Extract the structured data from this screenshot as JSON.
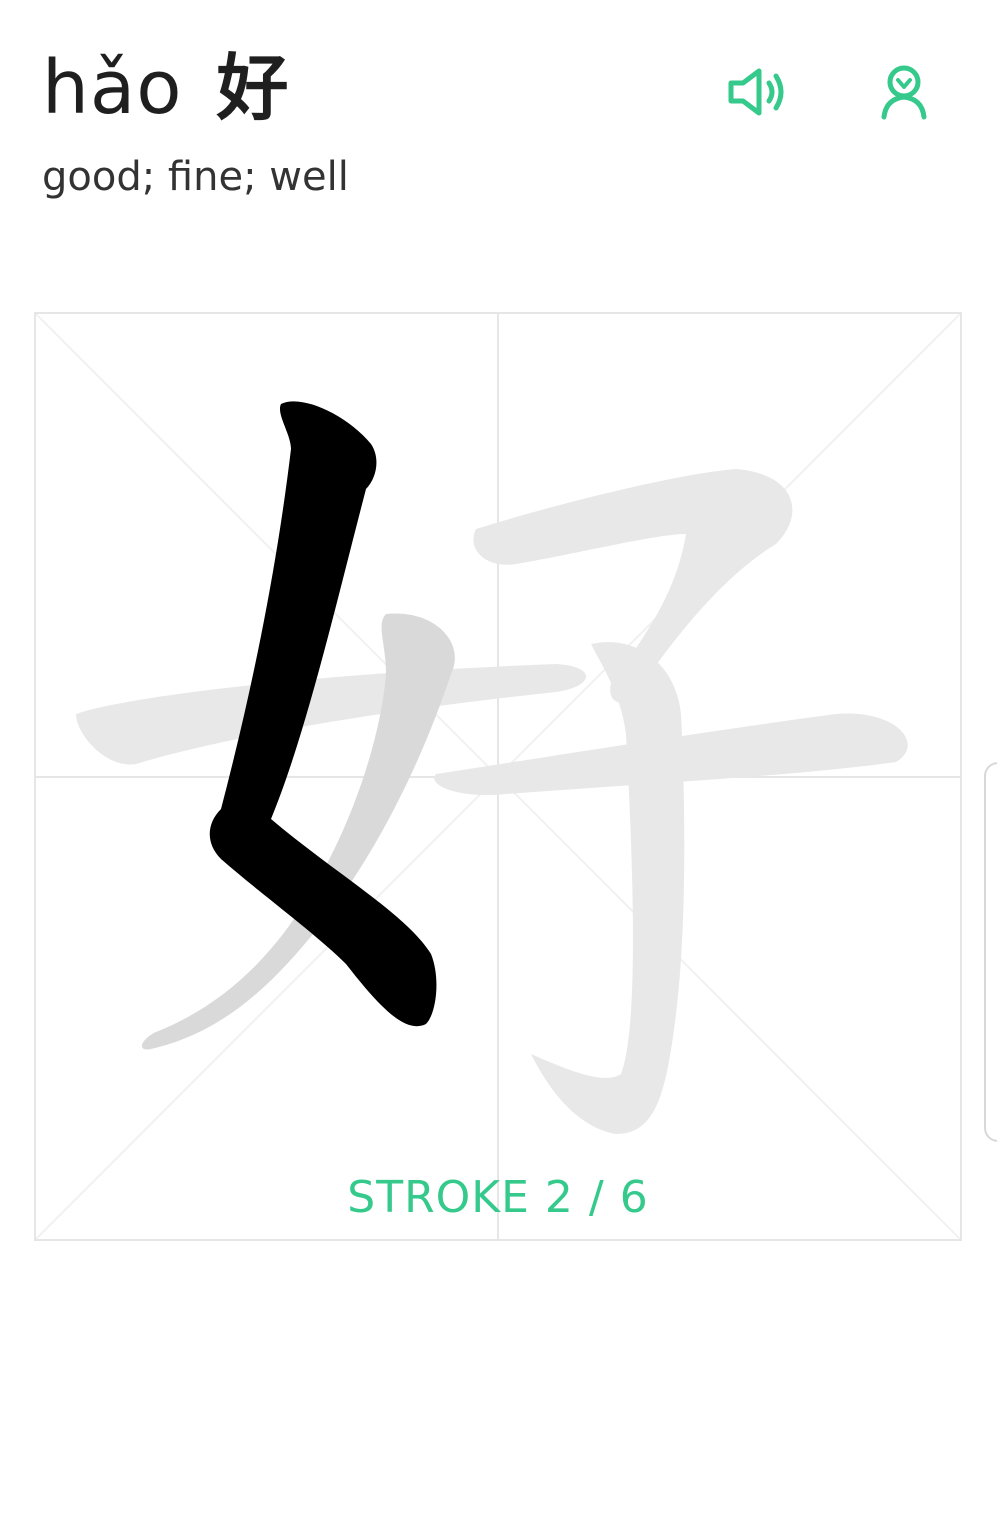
{
  "word": {
    "pinyin": "hǎo",
    "hanzi": "好",
    "meaning": "good; fine; well"
  },
  "actions": {
    "speaker_icon": "speaker-icon",
    "person_icon": "person-icon"
  },
  "practice": {
    "stroke_label": "STROKE 2 / 6",
    "current_stroke": 2,
    "total_strokes": 6
  },
  "colors": {
    "accent": "#35c98c",
    "active_stroke": "#000000",
    "pending_stroke": "#e8e8e8",
    "next_stroke": "#d9d9d9",
    "grid": "#e6e6e6"
  }
}
